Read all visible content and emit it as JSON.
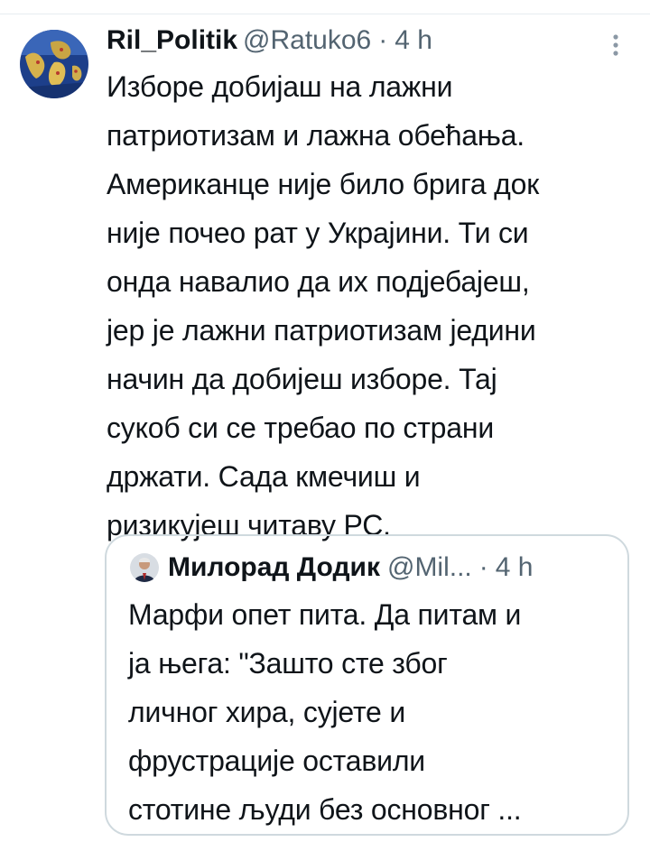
{
  "tweet": {
    "display_name": "Ril_Politik",
    "handle": "@Ratuko6",
    "separator": "·",
    "time": "4 h",
    "text": "Изборе добијаш на лажни\nпатриотизам и лажна обећања.\nАмериканце није било брига док\nније почео рат у Украјини. Ти си\nонда навалио да их подјебајеш,\nјер је лажни патриотизам једини\nначин да добијеш изборе. Тај\nсукоб си се требао по страни\nдржати. Сада кмечиш и\nризикујеш читаву РС.",
    "more_icon": "more-vertical-icon",
    "avatar_icon": "world-map-avatar"
  },
  "quote": {
    "display_name": "Милорад Додик",
    "handle": "@Mil...",
    "separator": "·",
    "time": "4 h",
    "text": "Марфи опет пита. Да питам и\nја њега: \"Зашто сте због\nличног хира, сујете и\nфрустрације оставили\nстотине људи без основног ...",
    "avatar_icon": "person-avatar"
  },
  "colors": {
    "text_primary": "#0f1419",
    "text_secondary": "#536471",
    "border": "#cfd9de",
    "background": "#ffffff"
  }
}
